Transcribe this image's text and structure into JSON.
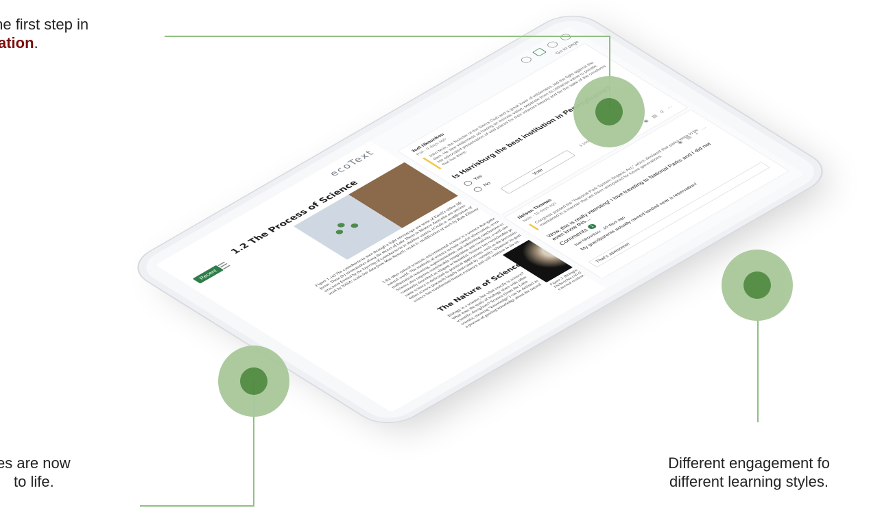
{
  "callouts": {
    "top_line1": "the first step in",
    "top_line2": "zation",
    "top_line2_suffix": ".",
    "bottom_left_line1": "ces are now",
    "bottom_left_line2": "to life.",
    "bottom_right_line1": "Different engagement fo",
    "bottom_right_line2": "different learning styles."
  },
  "colors": {
    "highlight": "#7a0e0e",
    "hotspot_outer": "#a9c89a",
    "hotspot_inner": "#4f8a3f",
    "brand_green": "#2f7d4a"
  },
  "app": {
    "brand": "ecoText",
    "recent_label": "Recent",
    "goto_page_label": "Go to page"
  },
  "book": {
    "chapter_title": "1.2 The Process of Science",
    "figure1_caption": "Figure 1. (a) The cyanobacteria seen through a light microscope are some of Earth's oldest life forms. These (b) stromatolites along the shores of Lake Thetis in Western Australia are ancient structures formed by the layering of cyanobacteria in shallow waters. (Credit a: modification of work by NASA; scale-bar data from Matt Russell; credit b: modification of work by Ruth Ellison)",
    "body_paragraph1": "Like other natural sciences, environmental science is a science that gathers knowledge about the natural world. The methods of science include careful observation, record keeping, logical and mathematical reasoning, experimentation, and submitting conclusions to the scrutiny of others. Science also requires considerable imagination and creativity; a well-designed experiment is commonly described as elegant or beautiful. Science has considerable practical implications and some science is dedicated to practical applications, such as the prevention of disease (Figure 2). Other science proceeds largely motivated by curiosity. Whatever its goal, there is no doubt that science has transformed human existence and will continue to do so.",
    "section_title": "The Nature of Science",
    "body_paragraph2": "Biology is a science, but what exactly is science? What does the study of biology share with other scientific disciplines? Science (from the Latin scientia, meaning \"knowledge\") can be defined as a process of gaining knowledge about the natural",
    "figure2_caption": "Figure 2. Biologists may choose to study Escherichia coli (E. coli), a bacterium that is a normal resident of"
  },
  "posts": [
    {
      "author": "Joel Nkounkou",
      "meta": "Poll · 9 days ago",
      "quote": "John Muir, the founder of the Sierra Club and a great lover of wilderness, led the fight against the dam. He saw wilderness as having an intrinsic value, separate from its utilitarian value to people. He advocated preservation of wild places for their inherent beauty and for the sake of the creatures that live there.",
      "question": "Is Harrisburg the best institution in Pennsylvania?",
      "options": [
        "Yes",
        "No"
      ],
      "vote_label": "Vote",
      "vote_count": "1 vote",
      "comment_count": "0"
    },
    {
      "author": "Nelson Thomas",
      "meta": "Note · 10 days ago",
      "quote": "Congress passed the \"National Park System Organic Act,\" which declared that parks were to be maintained in a manner that left them unimpaired for future generations.",
      "text": "Wow, this is really intersting! I love traveling to National Parks and I did not even know this...",
      "comments_label": "Comments",
      "comments_badge": "1",
      "reply_author": "Joel Nkounkou · 10 days ago",
      "reply_text": "My grandparents actually owned landed near a reservation!",
      "reply_input": "That's awesome!",
      "comment_count": "1"
    }
  ]
}
